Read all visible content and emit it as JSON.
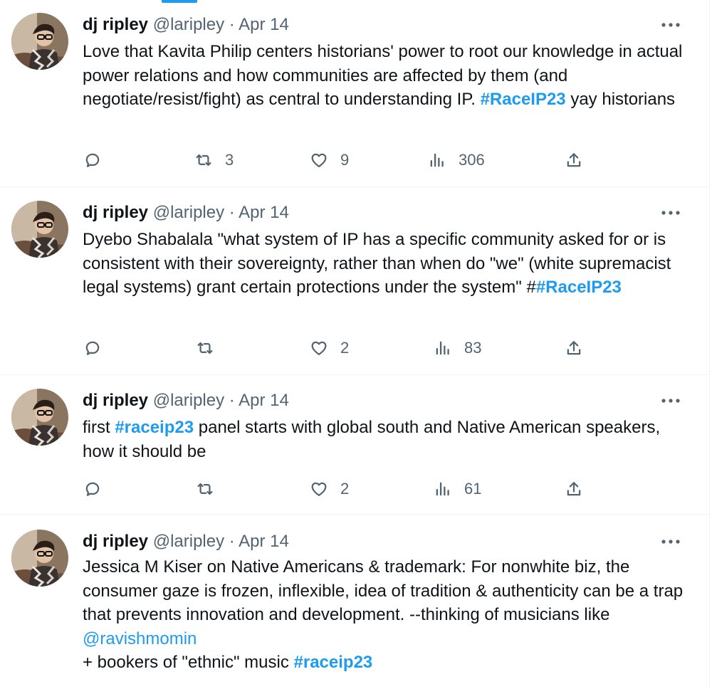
{
  "tweets": [
    {
      "author": {
        "name": "dj ripley",
        "handle": "@laripley"
      },
      "separator": "·",
      "date": "Apr 14",
      "text_parts": [
        "Love that Kavita Philip centers historians' power to root our knowledge in actual power relations and how communities are affected by them (and negotiate/resist/fight) as central to understanding IP.  ",
        "#RaceIP23",
        " yay historians"
      ],
      "stats": {
        "replies": "",
        "retweets": "3",
        "likes": "9",
        "views": "306"
      }
    },
    {
      "author": {
        "name": "dj ripley",
        "handle": "@laripley"
      },
      "separator": "·",
      "date": "Apr 14",
      "text_parts": [
        "Dyebo Shabalala \"what system of IP has a specific community asked for or is consistent with their sovereignty, rather than when do \"we\" (white supremacist legal systems) grant certain protections under the system\" #",
        "#RaceIP23"
      ],
      "stats": {
        "replies": "",
        "retweets": "",
        "likes": "2",
        "views": "83"
      }
    },
    {
      "author": {
        "name": "dj ripley",
        "handle": "@laripley"
      },
      "separator": "·",
      "date": "Apr 14",
      "text_parts": [
        "first ",
        "#raceip23",
        " panel starts with global south and Native American speakers,  how it should be"
      ],
      "stats": {
        "replies": "",
        "retweets": "",
        "likes": "2",
        "views": "61"
      }
    },
    {
      "author": {
        "name": "dj ripley",
        "handle": "@laripley"
      },
      "separator": "·",
      "date": "Apr 14",
      "text_parts": [
        "Jessica M Kiser on Native Americans & trademark: For nonwhite biz, the consumer gaze is frozen, inflexible,  idea of tradition & authenticity can be a trap that prevents innovation and development. --thinking of musicians like ",
        "@ravishmomin",
        "+ bookers of \"ethnic\" music ",
        "#raceip23"
      ],
      "stats": {
        "replies": "",
        "retweets": "",
        "likes": "",
        "views": ""
      }
    }
  ],
  "colors": {
    "accent": "#1d9bf0",
    "text": "#0f1419",
    "muted": "#536471",
    "border": "#eff3f4"
  },
  "icons": {
    "reply": "reply-icon",
    "retweet": "retweet-icon",
    "like": "heart-icon",
    "views": "views-icon",
    "share": "share-icon",
    "more": "more-icon"
  }
}
